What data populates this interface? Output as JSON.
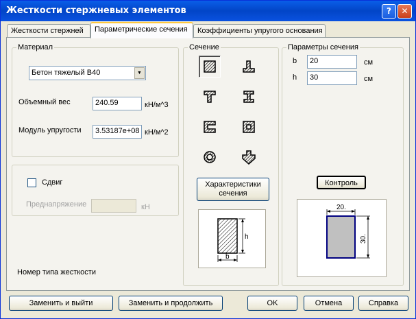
{
  "window": {
    "title": "Жесткости стержневых элементов"
  },
  "titlebar": {
    "help": "?",
    "close": "✕"
  },
  "tabs": [
    {
      "label": "Жесткости стержней"
    },
    {
      "label": "Параметрические сечения"
    },
    {
      "label": "Коэффициенты упругого основания"
    }
  ],
  "material": {
    "legend": "Материал",
    "selected": "Бетон тяжелый B40",
    "weight_label": "Объемный вес",
    "weight_value": "240.59",
    "weight_unit": "кН/м^3",
    "modulus_label": "Модуль упругости",
    "modulus_value": "3.53187e+08",
    "modulus_unit": "кН/м^2"
  },
  "shear": {
    "checkbox_label": "Сдвиг",
    "prestress_label": "Преднапряжение",
    "prestress_unit": "кН"
  },
  "stiffness_type_label": "Номер типа жесткости",
  "section": {
    "legend": "Сечение",
    "characteristics_line1": "Характеристики",
    "characteristics_line2": "сечения",
    "preview_h": "h",
    "preview_b": "b"
  },
  "params": {
    "legend": "Параметры сечения",
    "b_label": "b",
    "b_value": "20",
    "b_unit": "см",
    "h_label": "h",
    "h_value": "30",
    "h_unit": "см",
    "control_button": "Контроль",
    "preview_width": "20.",
    "preview_height": "30."
  },
  "buttons": {
    "replace_exit": "Заменить и выйти",
    "replace_continue": "Заменить и продолжить",
    "ok": "OK",
    "cancel": "Отмена",
    "help": "Справка"
  },
  "icons": [
    "rectangle-section-icon",
    "tee-section-icon",
    "i-beam-section-icon",
    "double-tee-section-icon",
    "channel-section-icon",
    "box-section-icon",
    "ring-section-icon",
    "cross-section-icon"
  ]
}
